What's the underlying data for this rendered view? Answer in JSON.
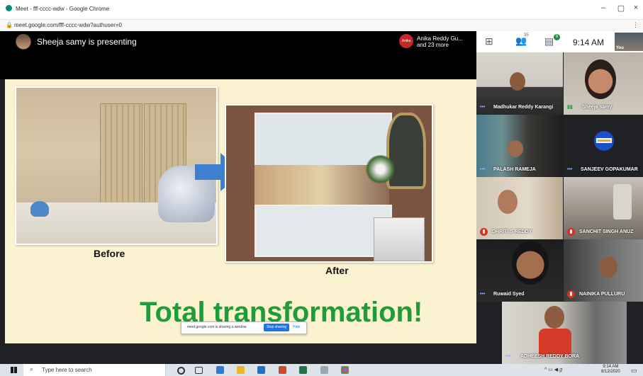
{
  "browser": {
    "tab_title": "Meet - fff-cccc-wdw - Google Chrome",
    "url": "meet.google.com/fff-cccc-wdw?authuser=0",
    "min": "–",
    "max": "▢",
    "close": "×"
  },
  "meet": {
    "presenter_text": "Sheeja samy is presenting",
    "participant_badge": "Anika",
    "participant_line1": "Anika Reddy Gu...",
    "participant_line2": "and 23 more",
    "people_count": "35",
    "chat_count": "8",
    "time": "9:14 AM",
    "self_label": "You"
  },
  "slide": {
    "before_caption": "Before",
    "after_caption": "After",
    "tagline": "Total transformation!"
  },
  "share_bar": {
    "message": "meet.google.com is sharing a window.",
    "stop_label": "Stop sharing",
    "hide_label": "Hide"
  },
  "participants": [
    {
      "name": "Madhukar Reddy Karangi"
    },
    {
      "name": "Sheeja samy"
    },
    {
      "name": "PALASH RAMEJA"
    },
    {
      "name": "SANJEEV GOPAKUMAR"
    },
    {
      "name": "DHRITI S REDDY"
    },
    {
      "name": "SANCHIT SINGH ANUZ"
    },
    {
      "name": "Ruwaid Syed"
    },
    {
      "name": "NAINIKA PULLURU"
    },
    {
      "name": "ADHEESH REDDY BORA"
    }
  ],
  "taskbar": {
    "search_placeholder": "Type here to search",
    "clock_time": "9:14 AM",
    "clock_date": "8/12/2020"
  },
  "colors": {
    "tagline_green": "#1f9c3a",
    "stop_blue": "#1a73e8",
    "mic_red": "#d93025"
  }
}
